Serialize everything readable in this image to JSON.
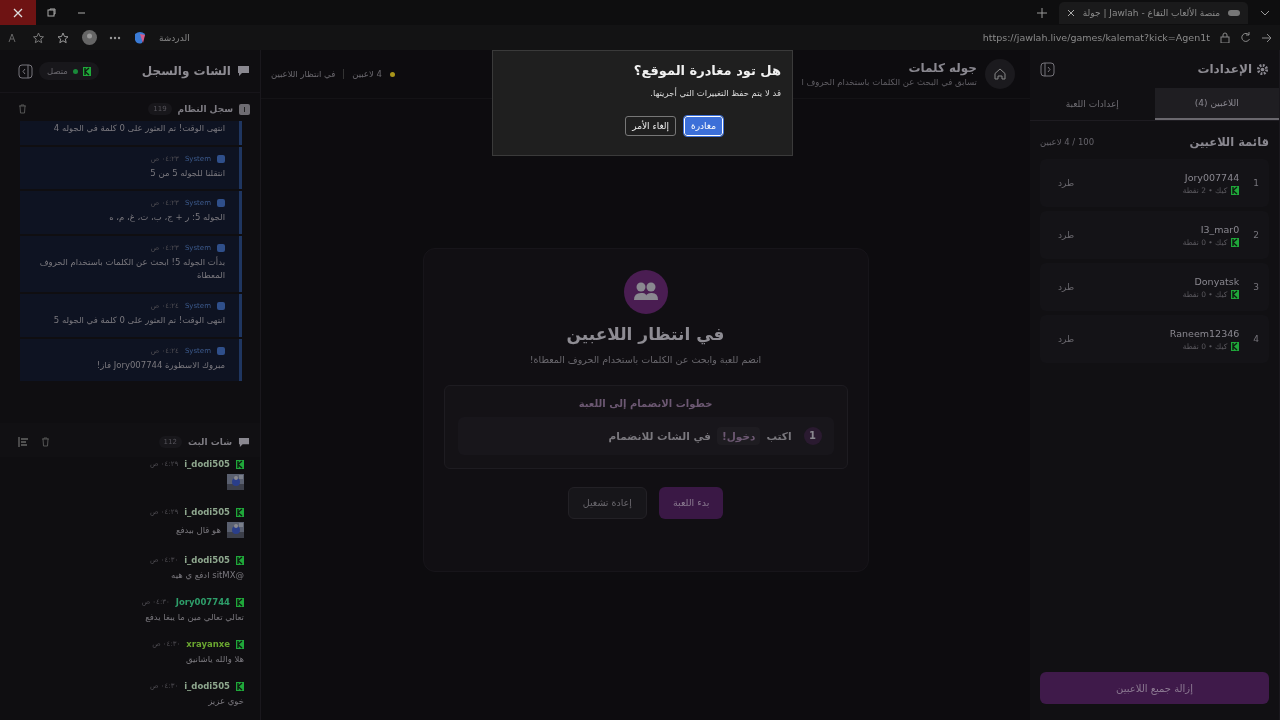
{
  "browser": {
    "tab_title": "جولة | Jawlah - منصة الألعاب التفاع",
    "url": "https://jawlah.live/games/kalemat?kick=Agen1t",
    "chat_label": "الدردشة"
  },
  "left_panel": {
    "title": "الشات والسجل",
    "status": "متصل",
    "system_log": {
      "title": "سجل النظام",
      "count": "119",
      "entries": [
        {
          "kind": "continued",
          "text": "انتهى الوقت! تم العثور على 0 كلمة في الجوله 4"
        },
        {
          "kind": "message",
          "author": "System",
          "time": "٠٤:٢٣ ص",
          "text": "انتقلنا للجوله 5 من 5"
        },
        {
          "kind": "message",
          "author": "System",
          "time": "٠٤:٢٣ ص",
          "text": "الجوله 5: ر + ج، ب، ت، غ، م، ه"
        },
        {
          "kind": "message",
          "author": "System",
          "time": "٠٤:٢٣ ص",
          "text": "بدأت الجوله 5! ابحث عن الكلمات باستخدام الحروف المعطاة"
        },
        {
          "kind": "message",
          "author": "System",
          "time": "٠٤:٢٤ ص",
          "text": "انتهى الوقت! تم العثور على 0 كلمة في الجوله 5"
        },
        {
          "kind": "message",
          "author": "System",
          "time": "٠٤:٢٤ ص",
          "text": "مبروك الاسطورة Jory007744 فاز!"
        }
      ]
    },
    "chat": {
      "title": "شات البث",
      "count": "112",
      "messages": [
        {
          "user": "i_dodi505",
          "color": "#8fa88f",
          "time": "٠٤:٢٩ ص"
        },
        {
          "kind": "image_text",
          "user": "i_dodi505",
          "color": "#8fa88f",
          "time": "٠٤:٢٩ ص",
          "text": "هو قال بيدفع"
        },
        {
          "kind": "text",
          "user": "i_dodi505",
          "color": "#8fa88f",
          "time": "٠٤:٣٠ ص",
          "text": "@sitMX ادفع ي هيه"
        },
        {
          "kind": "text",
          "user": "Jory007744",
          "color": "#2e9e6a",
          "time": "٠٤:٣٠ ص",
          "text": "تعالي تعالي مين ما يبغا يدفع"
        },
        {
          "kind": "text",
          "user": "xrayanxe",
          "color": "#6aa530",
          "time": "٠٤:٣٠ ص",
          "text": "هلا والله ياشانيق"
        },
        {
          "kind": "text",
          "user": "i_dodi505",
          "color": "#8fa88f",
          "time": "٠٤:٣٠ ص",
          "text": "خوي عزيز"
        }
      ]
    }
  },
  "center": {
    "header": {
      "title": "جوله كلمات",
      "subtitle": "تسابق في البحث عن الكلمات باستخدام الحروف ا",
      "players": "4 لاعبين",
      "status": "في انتظار اللاعبين"
    },
    "card": {
      "title": "في انتظار اللاعبين",
      "subtitle": "انضم للعبة وابحث عن الكلمات باستخدام الحروف المعطاة!",
      "steps_title": "خطوات الانضمام إلى اللعبة",
      "steps": [
        {
          "number": "1",
          "before": "اكتب",
          "command": "!دخول",
          "after": "في الشات للانضمام"
        }
      ],
      "buttons": [
        {
          "label": "بدء اللعبة",
          "kind": "primary"
        },
        {
          "label": "إعادة تشغيل",
          "kind": "secondary"
        }
      ]
    }
  },
  "right_panel": {
    "title": "الإعدادات",
    "tabs": [
      {
        "label": "اللاعبين (4)",
        "selected": true
      },
      {
        "label": "إعدادات اللعبة",
        "selected": false
      }
    ],
    "list_title": "قائمة اللاعبين",
    "capacity": "100 / 4 لاعبين",
    "players": [
      {
        "rank": "1",
        "name": "Jory007744",
        "meta": "كيك • 2 نقطة",
        "action": "طرد"
      },
      {
        "rank": "2",
        "name": "I3_mar0",
        "meta": "كيك • 0 نقطة",
        "action": "طرد"
      },
      {
        "rank": "3",
        "name": "Donyatsk",
        "meta": "كيك • 0 نقطة",
        "action": "طرد"
      },
      {
        "rank": "4",
        "name": "Raneem12346",
        "meta": "كيك • 0 نقطة",
        "action": "طرد"
      }
    ],
    "footer_button": "إزالة جميع اللاعبين"
  },
  "dialog": {
    "title": "هل تود مغادرة الموقع؟",
    "message": "قد لا يتم حفظ التغييرات التي أجريتها.",
    "buttons": [
      {
        "label": "مغادرة",
        "kind": "primary"
      },
      {
        "label": "إلغاء الأمر",
        "kind": "secondary"
      }
    ]
  }
}
